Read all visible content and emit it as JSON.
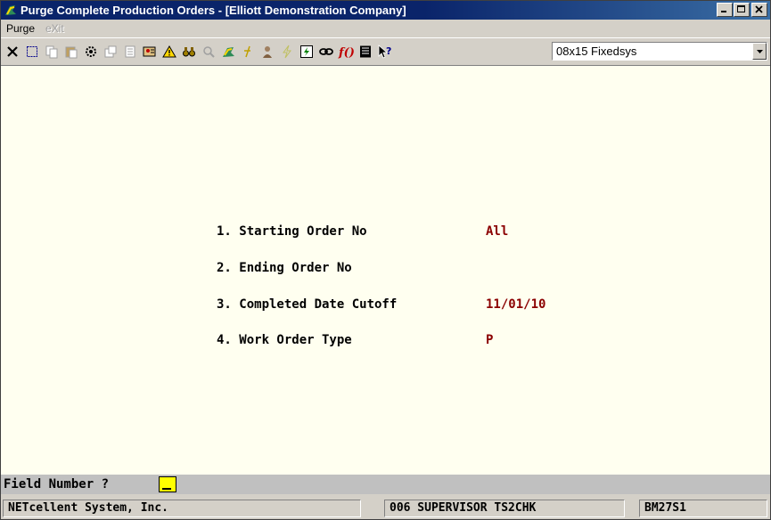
{
  "window": {
    "title": "Purge Complete Production Orders - [Elliott Demonstration Company]"
  },
  "menu": {
    "items": [
      {
        "label": "Purge",
        "enabled": true
      },
      {
        "label": "eXit",
        "enabled": false
      }
    ]
  },
  "toolbar": {
    "icons": [
      "close-x-icon",
      "select-rect-icon",
      "copy-icon",
      "paste-icon",
      "settings-gear-icon",
      "properties-icon",
      "document-icon",
      "user-card-icon",
      "alert-triangle-icon",
      "binoculars-icon",
      "magnify-icon",
      "world-icon",
      "text-tool-icon",
      "person-icon",
      "lightning-icon",
      "macro-icon",
      "link-icon",
      "function-icon",
      "list-icon",
      "help-pointer-icon"
    ],
    "font_select": "08x15 Fixedsys"
  },
  "form": {
    "fields": [
      {
        "label": "1. Starting Order No",
        "value": "All"
      },
      {
        "label": "2. Ending Order No",
        "value": ""
      },
      {
        "label": "3. Completed Date Cutoff",
        "value": "11/01/10"
      },
      {
        "label": "4. Work Order Type",
        "value": "P"
      }
    ]
  },
  "prompt": {
    "text": "Field Number ?"
  },
  "status": {
    "company": "NETcellent System, Inc.",
    "user": "006 SUPERVISOR TS2CHK",
    "program": "BM27S1"
  },
  "colors": {
    "value_text": "#8b0000",
    "screen_bg": "#fffff0",
    "title_bg": "#0a246a"
  }
}
